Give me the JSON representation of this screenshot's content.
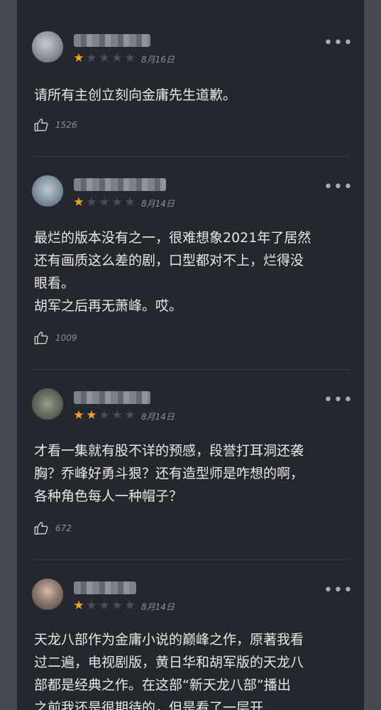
{
  "reviews": [
    {
      "username": "",
      "rating": 1,
      "max_rating": 5,
      "date": "8月16日",
      "text": "请所有主创立刻向金庸先生道歉。",
      "likes": "1526"
    },
    {
      "username": "",
      "rating": 1,
      "max_rating": 5,
      "date": "8月14日",
      "text": "最烂的版本没有之一，很难想象2021年了居然\n还有画质这么差的剧，口型都对不上，烂得没\n眼看。\n胡军之后再无萧峰。哎。",
      "likes": "1009"
    },
    {
      "username": "",
      "rating": 2,
      "max_rating": 5,
      "date": "8月14日",
      "text": "才看一集就有股不详的预感，段誉打耳洞还袭\n胸？乔峰好勇斗狠？还有造型师是咋想的啊，\n各种角色每人一种帽子？",
      "likes": "672"
    },
    {
      "username": "",
      "rating": 1,
      "max_rating": 5,
      "date": "8月14日",
      "text": "天龙八部作为金庸小说的巅峰之作，原著我看\n过二遍，电视剧版，黄日华和胡军版的天龙八\n部都是经典之作。在这部“新天龙八部”播出\n之前我还是很期待的，但是看了一层开",
      "likes": ""
    }
  ],
  "colors": {
    "background": "#24272d",
    "star_active": "#f6a21c",
    "star_inactive": "#4b4f56",
    "text": "#e6e8ea",
    "muted": "#8c9097"
  },
  "icons": {
    "more": "more-dots-icon",
    "like": "thumbs-up-icon",
    "star": "star-icon"
  }
}
